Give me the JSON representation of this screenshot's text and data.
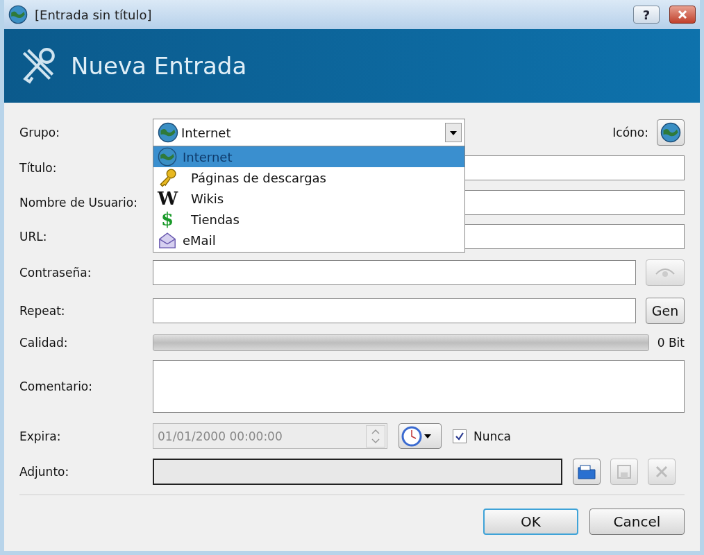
{
  "window": {
    "title": "[Entrada sin título]",
    "help_glyph": "?"
  },
  "header": {
    "title": "Nueva Entrada"
  },
  "group": {
    "label": "Grupo:",
    "value": "Internet",
    "expanded": true,
    "options": [
      {
        "label": "Internet",
        "kind": "globe",
        "selected": true
      },
      {
        "label": "Páginas de descargas",
        "kind": "key",
        "selected": false
      },
      {
        "label": "Wikis",
        "kind": "glyph",
        "glyph": "W",
        "selected": false
      },
      {
        "label": "Tiendas",
        "kind": "glyph",
        "glyph": "$",
        "selected": false
      },
      {
        "label": "eMail",
        "kind": "mail",
        "selected": false
      }
    ]
  },
  "icon_label": "Icóno:",
  "title_label": "Título:",
  "username_label": "Nombre de Usuario:",
  "url_label": "URL:",
  "password": {
    "label": "Contraseña:",
    "reveal_disabled": true
  },
  "repeat": {
    "label": "Repeat:",
    "gen_button": "Gen"
  },
  "quality": {
    "label": "Calidad:",
    "level": 0,
    "reading": "0 Bit"
  },
  "comment_label": "Comentario:",
  "expires": {
    "label": "Expira:",
    "value": "01/01/2000 00:00:00",
    "disabled": true,
    "never_label": "Nunca",
    "never_checked": true
  },
  "attachment": {
    "label": "Adjunto:",
    "save_disabled": true,
    "delete_disabled": true
  },
  "buttons": [
    "OK",
    "Cancel"
  ]
}
